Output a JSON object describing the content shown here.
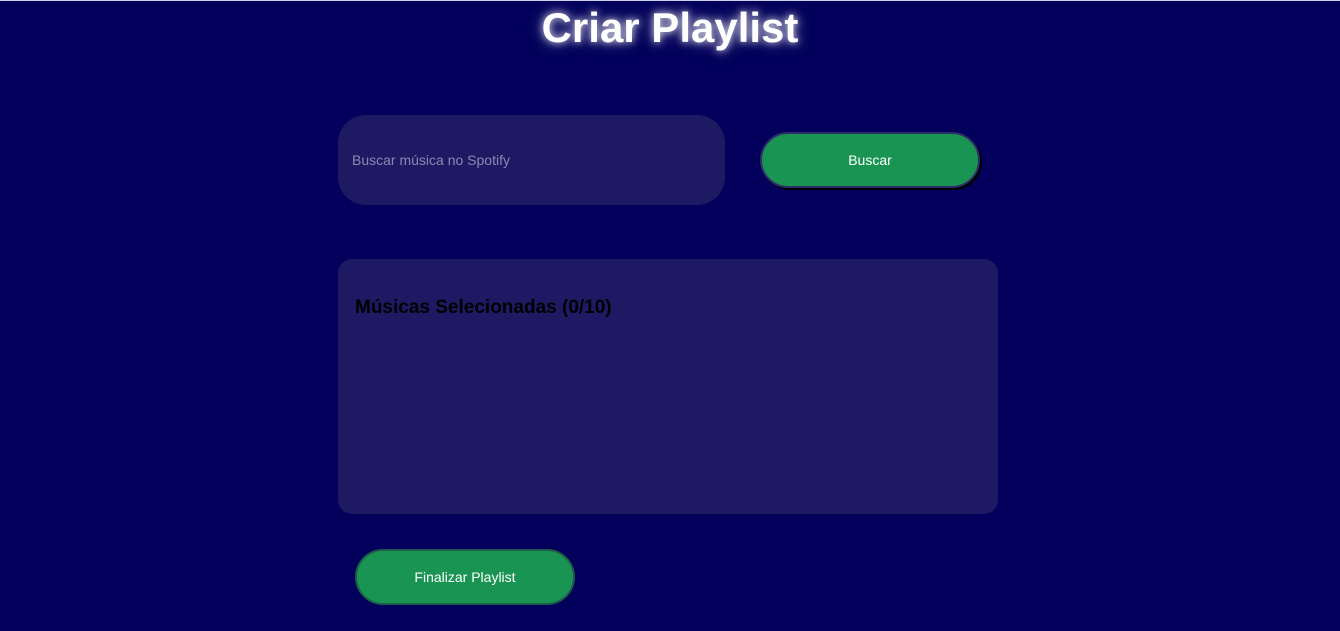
{
  "header": {
    "title": "Criar Playlist"
  },
  "search": {
    "placeholder": "Buscar música no Spotify",
    "value": "",
    "button_label": "Buscar"
  },
  "selected": {
    "heading": "Músicas Selecionadas (0/10)",
    "count": 0,
    "max": 10,
    "items": []
  },
  "actions": {
    "finalize_label": "Finalizar Playlist"
  },
  "colors": {
    "background": "#02005a",
    "panel": "#1d1a63",
    "accent_green": "#1a9452",
    "title_text": "#ffffff"
  }
}
